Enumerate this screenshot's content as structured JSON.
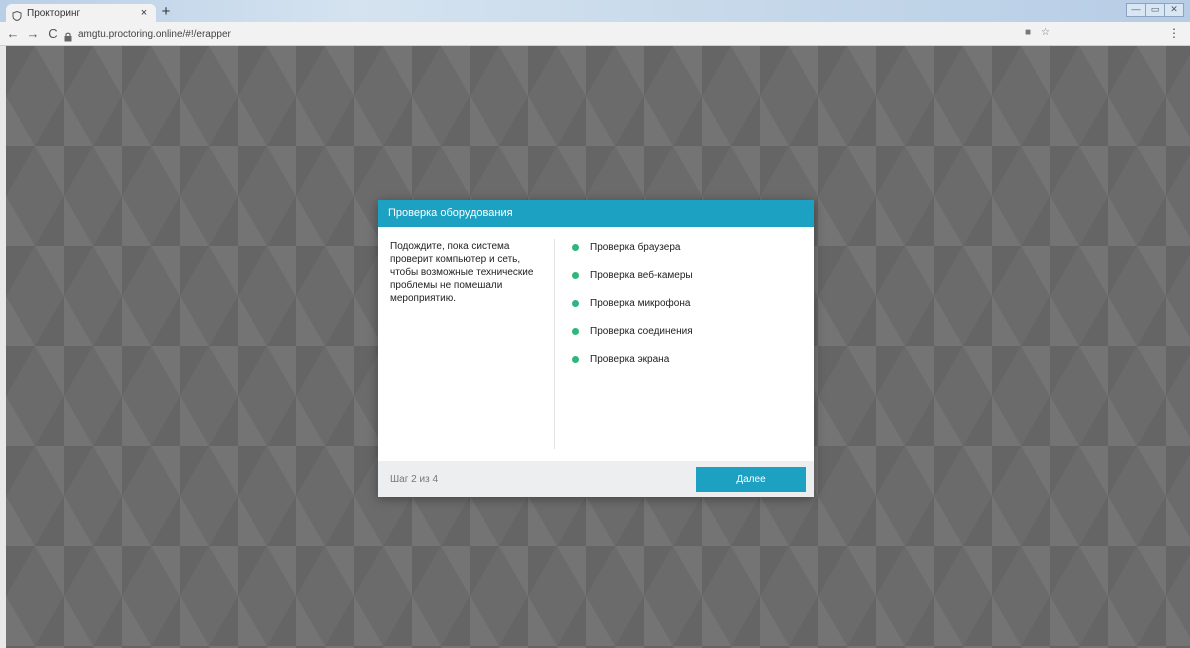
{
  "browser": {
    "tab_title": "Прокторинг",
    "tab_close": "×",
    "new_tab": "+",
    "url": "amgtu.proctoring.online/#!/erapper",
    "back": "←",
    "forward": "→",
    "reload": "C",
    "menu": "⋮",
    "window_controls": [
      "—",
      "▭",
      "✕"
    ]
  },
  "modal": {
    "title": "Проверка оборудования",
    "description": "Подождите, пока система проверит компьютер и сеть, чтобы возможные технические проблемы не помешали мероприятию.",
    "checks": [
      "Проверка браузера",
      "Проверка веб-камеры",
      "Проверка микрофона",
      "Проверка соединения",
      "Проверка экрана"
    ],
    "step": "Шаг 2 из 4",
    "next_label": "Далее"
  },
  "colors": {
    "accent": "#1ca1c3",
    "check_dot": "#2eb67d",
    "footer_bg": "#eceef0"
  }
}
